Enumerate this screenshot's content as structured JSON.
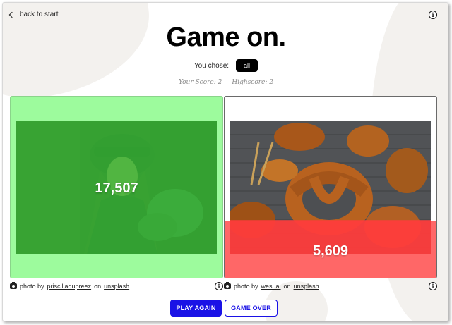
{
  "nav": {
    "back_label": "back to start"
  },
  "header": {
    "title": "Game on.",
    "you_chose_label": "You chose:",
    "choice": "all",
    "your_score": "Your Score: 2",
    "highscore": "Highscore: 2"
  },
  "cards": [
    {
      "count": "17,507",
      "state": "correct",
      "result_color": "#9dfb9d",
      "credit_prefix": "photo by",
      "credit_author": "priscilladupreez",
      "credit_on": "on",
      "credit_site": "unsplash",
      "fill_fraction": 1.0
    },
    {
      "count": "5,609",
      "state": "lower",
      "result_color": "#ff5a5a",
      "credit_prefix": "photo by",
      "credit_author": "wesual",
      "credit_on": "on",
      "credit_site": "unsplash",
      "fill_fraction": 0.32
    }
  ],
  "actions": {
    "play_again": "PLAY AGAIN",
    "game_over": "GAME OVER"
  },
  "colors": {
    "accent": "#1a12e6",
    "correct_bg": "#9dfb9d",
    "wrong_overlay": "#ff3c3c"
  }
}
